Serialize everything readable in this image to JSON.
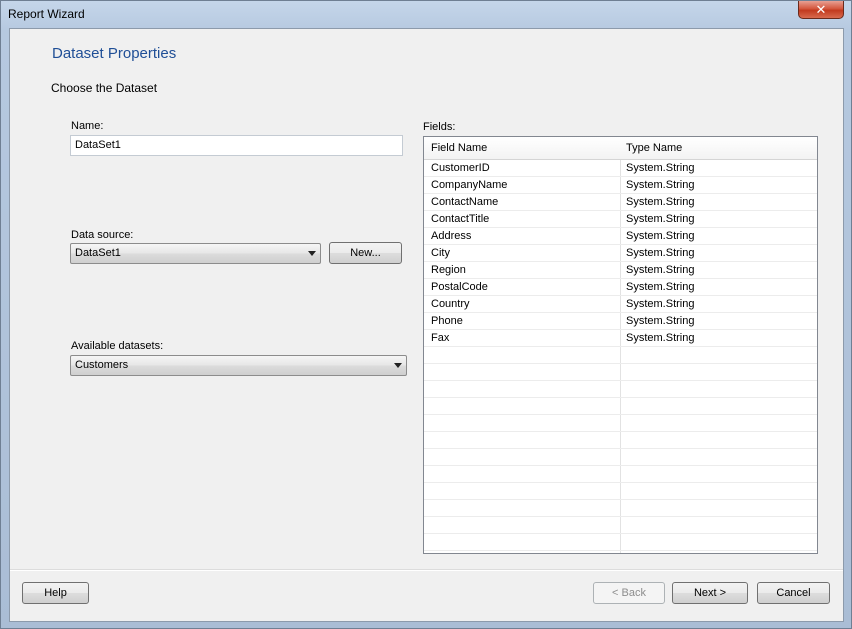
{
  "window": {
    "title": "Report Wizard",
    "close_glyph": "✕"
  },
  "page": {
    "heading": "Dataset Properties",
    "subheading": "Choose the Dataset"
  },
  "name": {
    "label": "Name:",
    "value": "DataSet1"
  },
  "data_source": {
    "label": "Data source:",
    "selected": "DataSet1",
    "new_button": "New..."
  },
  "available_datasets": {
    "label": "Available datasets:",
    "selected": "Customers"
  },
  "fields": {
    "label": "Fields:",
    "columns": [
      "Field Name",
      "Type Name"
    ],
    "rows": [
      [
        "CustomerID",
        "System.String"
      ],
      [
        "CompanyName",
        "System.String"
      ],
      [
        "ContactName",
        "System.String"
      ],
      [
        "ContactTitle",
        "System.String"
      ],
      [
        "Address",
        "System.String"
      ],
      [
        "City",
        "System.String"
      ],
      [
        "Region",
        "System.String"
      ],
      [
        "PostalCode",
        "System.String"
      ],
      [
        "Country",
        "System.String"
      ],
      [
        "Phone",
        "System.String"
      ],
      [
        "Fax",
        "System.String"
      ]
    ]
  },
  "buttons": {
    "help": "Help",
    "back": "< Back",
    "next": "Next >",
    "cancel": "Cancel"
  }
}
